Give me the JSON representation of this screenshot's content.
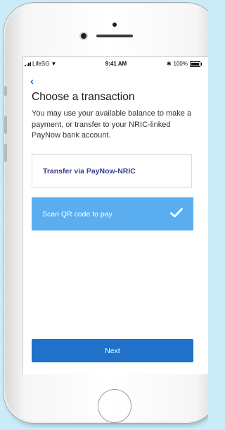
{
  "status_bar": {
    "carrier": "LifeSG",
    "time": "9:41 AM",
    "battery": "100%",
    "icons": [
      "signal-icon",
      "wifi-icon",
      "bluetooth-icon",
      "battery-icon"
    ]
  },
  "header": {
    "back_icon": "chevron-left-icon",
    "title": "Choose a transaction"
  },
  "description": "You may use your available balance to make a payment, or transfer to your NRIC-linked PayNow bank account.",
  "options": [
    {
      "label": "Transfer via PayNow-NRIC",
      "selected": false
    },
    {
      "label": "Scan QR code to pay",
      "selected": true,
      "icon": "check-icon"
    }
  ],
  "next_button": {
    "label": "Next"
  },
  "colors": {
    "background": "#c9ecf8",
    "accent": "#1a6ed8",
    "selected_option": "#5aaef0",
    "primary_button": "#1f71c9",
    "option_text": "#3a3f8f"
  }
}
